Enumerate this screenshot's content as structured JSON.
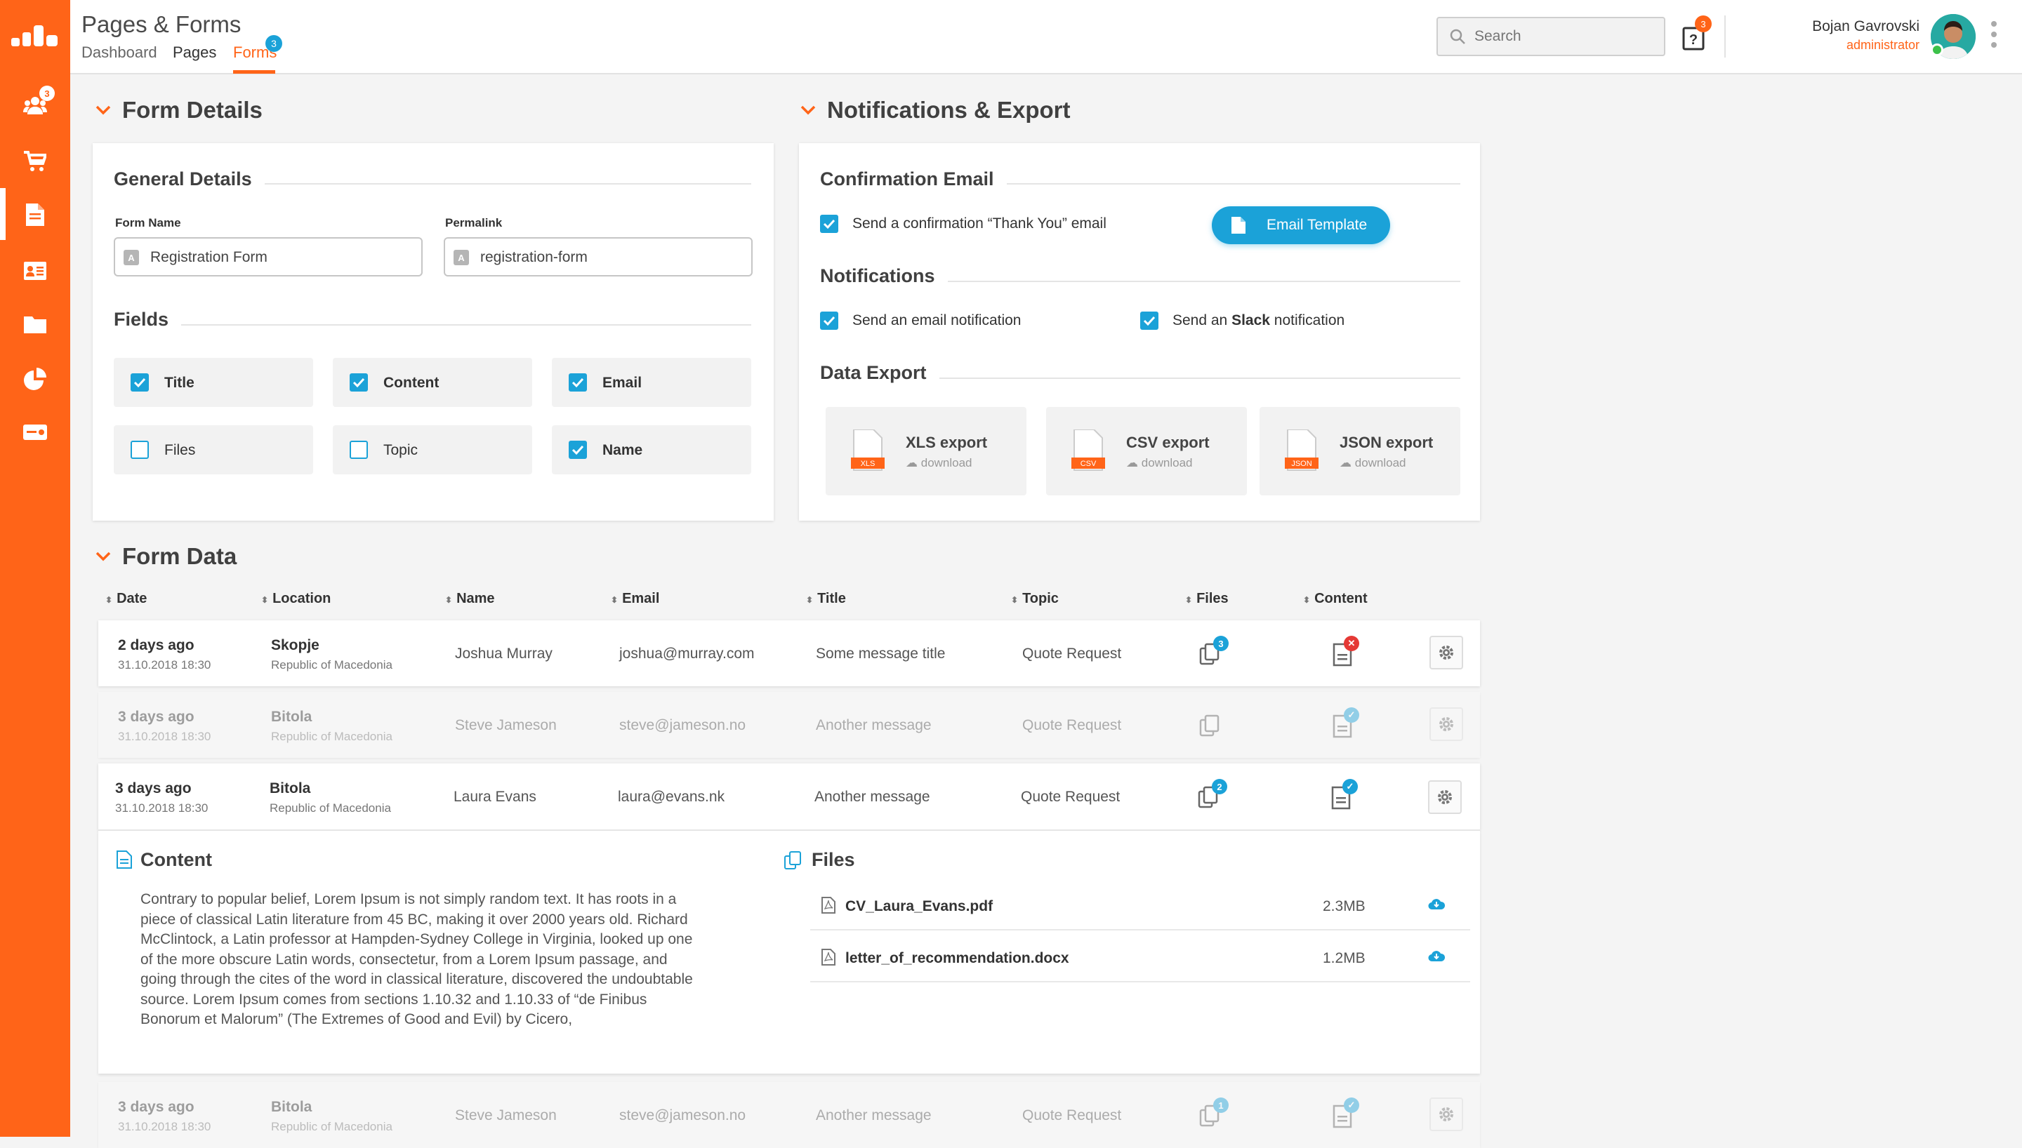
{
  "app": {
    "title": "Pages & Forms"
  },
  "tabs": [
    {
      "label": "Dashboard"
    },
    {
      "label": "Pages"
    },
    {
      "label": "Forms",
      "badge": "3"
    }
  ],
  "search": {
    "placeholder": "Search"
  },
  "help": {
    "badge": "3"
  },
  "user": {
    "name": "Bojan Gavrovski",
    "role": "administrator"
  },
  "sidebar": {
    "items": [
      {
        "icon": "users-icon",
        "badge": "3"
      },
      {
        "icon": "cart-icon"
      },
      {
        "icon": "page-icon",
        "active": true
      },
      {
        "icon": "contact-card-icon"
      },
      {
        "icon": "folder-icon"
      },
      {
        "icon": "pie-chart-icon"
      },
      {
        "icon": "ticket-icon"
      }
    ]
  },
  "form_details": {
    "title": "Form Details",
    "general_title": "General Details",
    "form_name_label": "Form Name",
    "form_name_value": "Registration Form",
    "permalink_label": "Permalink",
    "permalink_value": "registration-form",
    "fields_title": "Fields",
    "fields": [
      {
        "label": "Title",
        "checked": true
      },
      {
        "label": "Content",
        "checked": true
      },
      {
        "label": "Email",
        "checked": true
      },
      {
        "label": "Files",
        "checked": false
      },
      {
        "label": "Topic",
        "checked": false
      },
      {
        "label": "Name",
        "checked": true
      }
    ]
  },
  "notifications": {
    "title": "Notifications & Export",
    "confirmation_title": "Confirmation Email",
    "confirmation_label": "Send a confirmation “Thank You” email",
    "email_template_button": "Email Template",
    "notifications_title": "Notifications",
    "email_notification_label": "Send an email notification",
    "slack_prefix": "Send an ",
    "slack_bold": "Slack",
    "slack_suffix": " notification",
    "export_title": "Data Export",
    "exports": [
      {
        "name": "XLS export",
        "tag": "XLS",
        "action": "download"
      },
      {
        "name": "CSV export",
        "tag": "CSV",
        "action": "download"
      },
      {
        "name": "JSON export",
        "tag": "JSON",
        "action": "download"
      }
    ]
  },
  "form_data": {
    "title": "Form Data",
    "columns": [
      "Date",
      "Location",
      "Name",
      "Email",
      "Title",
      "Topic",
      "Files",
      "Content"
    ],
    "rows": [
      {
        "date": "2 days ago",
        "datetime": "31.10.2018 18:30",
        "city": "Skopje",
        "country": "Republic of Macedonia",
        "name": "Joshua Murray",
        "email": "joshua@murray.com",
        "title": "Some message title",
        "topic": "Quote Request",
        "files_count": "3",
        "content_status": "error"
      },
      {
        "date": "3 days ago",
        "datetime": "31.10.2018 18:30",
        "city": "Bitola",
        "country": "Republic of Macedonia",
        "name": "Steve Jameson",
        "email": "steve@jameson.no",
        "title": "Another message",
        "topic": "Quote Request",
        "files_count": "",
        "content_status": "ok"
      },
      {
        "date": "3 days ago",
        "datetime": "31.10.2018 18:30",
        "city": "Bitola",
        "country": "Republic of Macedonia",
        "name": "Laura Evans",
        "email": "laura@evans.nk",
        "title": "Another message",
        "topic": "Quote Request",
        "files_count": "2",
        "content_status": "ok"
      },
      {
        "date": "3 days ago",
        "datetime": "31.10.2018 18:30",
        "city": "Bitola",
        "country": "Republic of Macedonia",
        "name": "Steve Jameson",
        "email": "steve@jameson.no",
        "title": "Another message",
        "topic": "Quote Request",
        "files_count": "1",
        "content_status": "ok"
      }
    ],
    "expanded": {
      "content_title": "Content",
      "content_text": "Contrary to popular belief, Lorem Ipsum is not simply random text. It has roots in a piece of classical Latin literature from 45 BC, making it over 2000 years old. Richard McClintock, a Latin professor at Hampden-Sydney College in Virginia, looked up one of the more obscure Latin words, consectetur, from a Lorem Ipsum passage, and going through the cites of the word in classical literature, discovered the undoubtable source. Lorem Ipsum comes from sections 1.10.32 and 1.10.33 of “de Finibus Bonorum et Malorum” (The Extremes of Good and Evil) by Cicero,",
      "files_title": "Files",
      "files": [
        {
          "name": "CV_Laura_Evans.pdf",
          "size": "2.3MB"
        },
        {
          "name": "letter_of_recommendation.docx",
          "size": "1.2MB"
        }
      ]
    }
  },
  "colors": {
    "accent": "#ff6418",
    "primary": "#1ba2d8",
    "error": "#e53935"
  }
}
